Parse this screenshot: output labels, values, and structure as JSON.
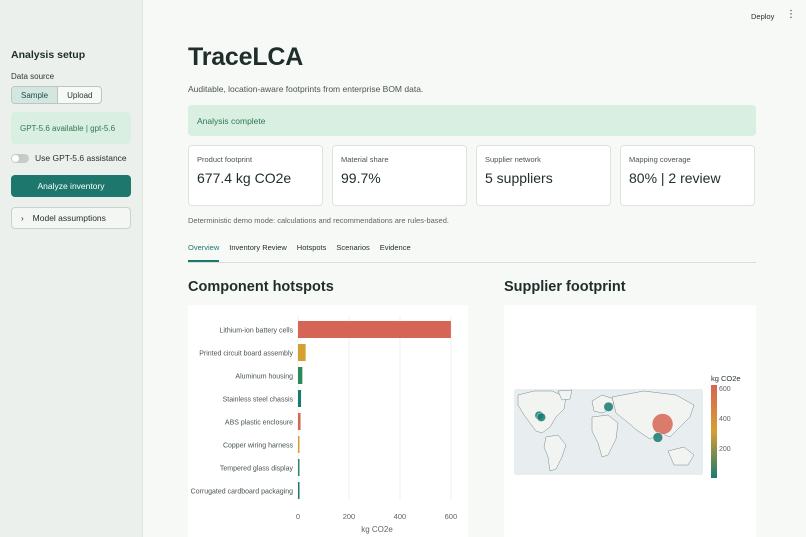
{
  "header": {
    "deploy_label": "Deploy",
    "menu_glyph": "⋮"
  },
  "sidebar": {
    "title": "Analysis setup",
    "data_source_label": "Data source",
    "data_source_options": [
      "Sample",
      "Upload"
    ],
    "ai_status": "GPT-5.6 available | gpt-5.6",
    "toggle_label": "Use GPT-5.6 assistance",
    "analyze_button": "Analyze inventory",
    "assumptions_label": "Model assumptions"
  },
  "main": {
    "title": "TraceLCA",
    "subtitle": "Auditable, location-aware footprints from enterprise BOM data.",
    "status": "Analysis complete",
    "metrics": [
      {
        "label": "Product footprint",
        "value": "677.4 kg CO2e"
      },
      {
        "label": "Material share",
        "value": "99.7%"
      },
      {
        "label": "Supplier network",
        "value": "5 suppliers"
      },
      {
        "label": "Mapping coverage",
        "value": "80% | 2 review"
      }
    ],
    "note": "Deterministic demo mode: calculations and recommendations are rules-based.",
    "tabs": [
      "Overview",
      "Inventory Review",
      "Hotspots",
      "Scenarios",
      "Evidence"
    ],
    "hotspots_title": "Component hotspots",
    "supplier_title": "Supplier footprint"
  },
  "chart_data": [
    {
      "type": "bar",
      "orientation": "horizontal",
      "categories": [
        "Lithium-ion battery cells",
        "Printed circuit board assembly",
        "Aluminum housing",
        "Stainless steel chassis",
        "ABS plastic enclosure",
        "Copper wiring harness",
        "Tempered glass display",
        "Corrugated cardboard packaging"
      ],
      "values": [
        600,
        30,
        17,
        12,
        10,
        5,
        2,
        1
      ],
      "colors": [
        "#d66555",
        "#d6a030",
        "#2a8a5c",
        "#1a7a70",
        "#d66555",
        "#d6a030",
        "#2a8a5c",
        "#1a7a70"
      ],
      "xlabel": "kg CO2e",
      "xlim": [
        0,
        620
      ],
      "xticks": [
        0,
        200,
        400,
        600
      ],
      "grid": true
    },
    {
      "type": "scatter",
      "subtype": "geo",
      "points": [
        {
          "lon": -122,
          "lat": 37,
          "value": 10
        },
        {
          "lon": -118,
          "lat": 34,
          "value": 10
        },
        {
          "lon": 10,
          "lat": 51,
          "value": 20
        },
        {
          "lon": 113,
          "lat": 23,
          "value": 600
        },
        {
          "lon": 104,
          "lat": 1,
          "value": 25
        }
      ],
      "colorbar": {
        "title": "kg CO2e",
        "ticks": [
          200,
          400,
          600
        ],
        "range": [
          0,
          620
        ]
      }
    }
  ]
}
